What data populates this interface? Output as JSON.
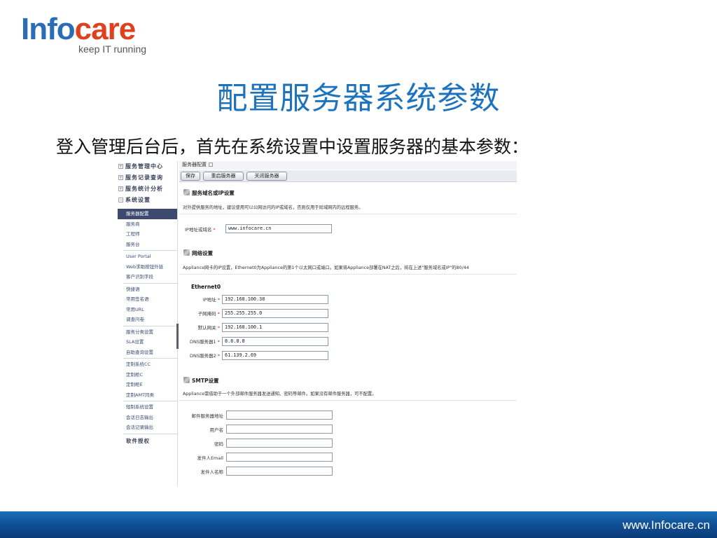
{
  "logo": {
    "part1": "Info",
    "part2": "care",
    "tagline": "keep IT running"
  },
  "slide": {
    "title": "配置服务器系统参数",
    "subtitle": "登入管理后台后，首先在系统设置中设置服务器的基本参数："
  },
  "footer": {
    "url": "www.Infocare.cn"
  },
  "sidebar": {
    "groups": [
      {
        "label": "服务管理中心",
        "toggle": "+"
      },
      {
        "label": "服务记录查询",
        "toggle": "+"
      },
      {
        "label": "服务统计分析",
        "toggle": "+"
      },
      {
        "label": "系统设置",
        "toggle": "−"
      }
    ],
    "items": [
      "服务器配置",
      "服务商",
      "工程师",
      "服务台",
      "User Portal",
      "Web求助按钮外链",
      "客户识别字段",
      "快捷语",
      "常用签名语",
      "常用URL",
      "调查问卷",
      "服务分类设置",
      "SLA设置",
      "自助查询设置",
      "定制系统CC",
      "定制柜C",
      "定制柜E",
      "定制AMT同类",
      "短制系统设置",
      "会话日志输出",
      "会话记录输出"
    ],
    "footer_item": "软件授权"
  },
  "page": {
    "header": "服务器配置",
    "toolbar": {
      "save": "保存",
      "restart": "重启服务器",
      "shutdown": "关闭服务器"
    },
    "domain_section": {
      "title": "服务域名或IP设置",
      "desc": "对外提供服务的地址，建议使用可以公网访问的IP或域名，否则仅用于局域网内的远程服务。",
      "field_label": "IP地址或域名",
      "field_value": "www.infocare.cn"
    },
    "network_section": {
      "title": "网络设置",
      "desc": "Appliance网卡的IP设置，Ethernet0为Appliance的第1个以太网口或端口。如果将Appliance部署在NAT之后，将在上述\"服务域名或IP\"的80/44",
      "subheader": "Ethernet0",
      "fields": [
        {
          "label": "IP地址",
          "value": "192.168.100.38"
        },
        {
          "label": "子网掩码",
          "value": "255.255.255.0"
        },
        {
          "label": "默认网关",
          "value": "192.168.100.1"
        },
        {
          "label": "DNS服务器1",
          "value": "8.8.8.8"
        },
        {
          "label": "DNS服务器2",
          "value": "61.139.2.69"
        }
      ]
    },
    "smtp_section": {
      "title": "SMTP设置",
      "desc": "Appliance需借助于一个外部邮件服务器发送通知、密码等邮件。如果没有邮件服务器，可不配置。",
      "fields": [
        {
          "label": "邮件服务器地址",
          "value": ""
        },
        {
          "label": "用户名",
          "value": ""
        },
        {
          "label": "密码",
          "value": ""
        },
        {
          "label": "发件人Email",
          "value": ""
        },
        {
          "label": "发件人名称",
          "value": ""
        }
      ]
    }
  },
  "colors": {
    "brand_blue": "#1e73be",
    "brand_red": "#e0401f",
    "footer_blue": "#0f4d92",
    "sidebar_active": "#3c4a70"
  }
}
